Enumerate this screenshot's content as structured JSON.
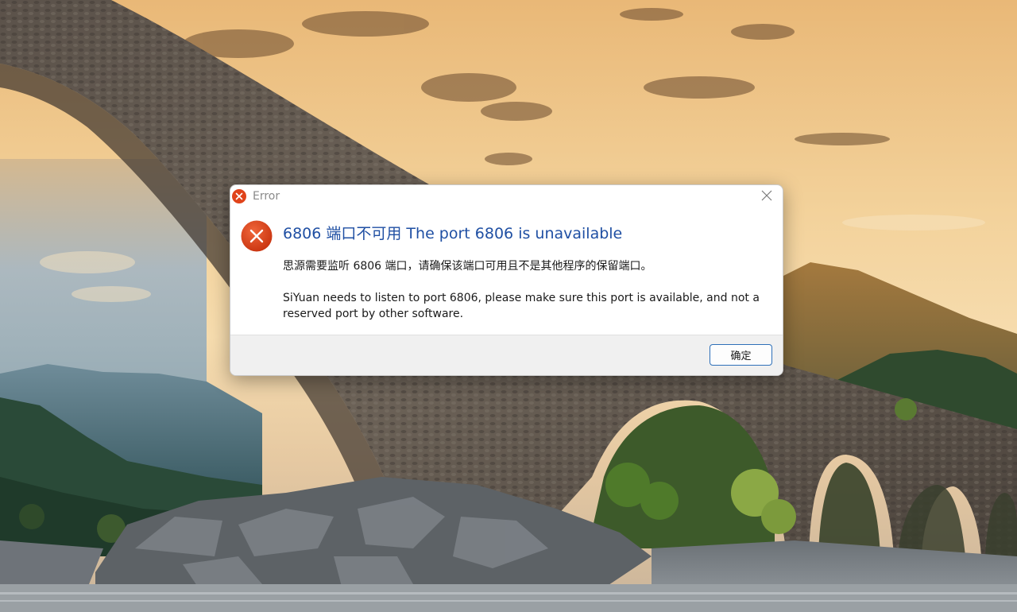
{
  "dialog": {
    "title": "Error",
    "main_instruction": "6806 端口不可用 The port 6806 is unavailable",
    "content_zh": "思源需要监听 6806 端口，请确保该端口可用且不是其他程序的保留端口。",
    "content_en": "SiYuan needs to listen to port 6806, please make sure this port is available, and not a reserved port by other software.",
    "ok_label": "确定",
    "icons": {
      "title": "error-icon",
      "content": "error-icon",
      "close": "close-icon"
    },
    "colors": {
      "error_red": "#e0431a",
      "instruction_blue": "#1f4fa3",
      "button_border": "#2d6fb8"
    }
  },
  "wallpaper": {
    "subject": "stone-arch-bridge-landscape"
  }
}
